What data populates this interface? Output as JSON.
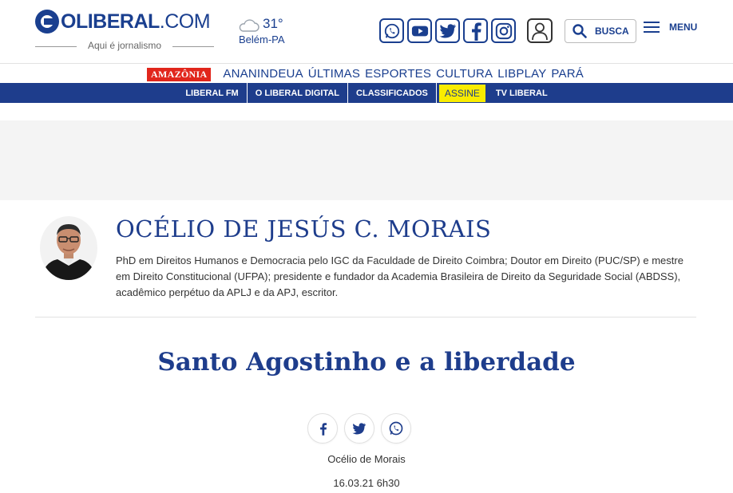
{
  "header": {
    "logo_text": "OLIBERAL",
    "logo_suffix": ".COM",
    "tagline": "Aqui é jornalismo",
    "weather": {
      "temperature": "31°",
      "city": "Belém-PA",
      "icon": "cloud-icon"
    },
    "social_icons": [
      "whatsapp-icon",
      "youtube-icon",
      "twitter-icon",
      "facebook-icon",
      "instagram-icon"
    ],
    "search_label": "BUSCA",
    "menu_label": "MENU",
    "brand_color": "#1a3f8f"
  },
  "subnav": {
    "amazonia_label": "AMAZÔNIA",
    "links": [
      "ANANINDEUA",
      "ÚLTIMAS",
      "ESPORTES",
      "CULTURA",
      "LIBPLAY",
      "PARÁ"
    ]
  },
  "bluebar": {
    "items": [
      "LIBERAL FM",
      "O LIBERAL DIGITAL",
      "CLASSIFICADOS",
      "ASSINE",
      "TV LIBERAL"
    ],
    "background": "#1e3d8c",
    "assine_color": "#f9ec00"
  },
  "author": {
    "name": "OCÉLIO DE JESÚS C. MORAIS",
    "bio": "PhD em Direitos Humanos e Democracia pelo IGC da Faculdade de Direito Coimbra; Doutor em Direito (PUC/SP) e mestre em Direito Constitucional (UFPA); presidente e fundador da Academia Brasileira de Direito da Seguridade Social (ABDSS), acadêmico perpétuo da APLJ e da APJ, escritor."
  },
  "article": {
    "title": "Santo Agostinho e a liberdade",
    "share_icons": [
      "facebook-icon",
      "twitter-icon",
      "whatsapp-icon"
    ],
    "byline": "Océlio de Morais",
    "date": "16.03.21 6h30"
  }
}
